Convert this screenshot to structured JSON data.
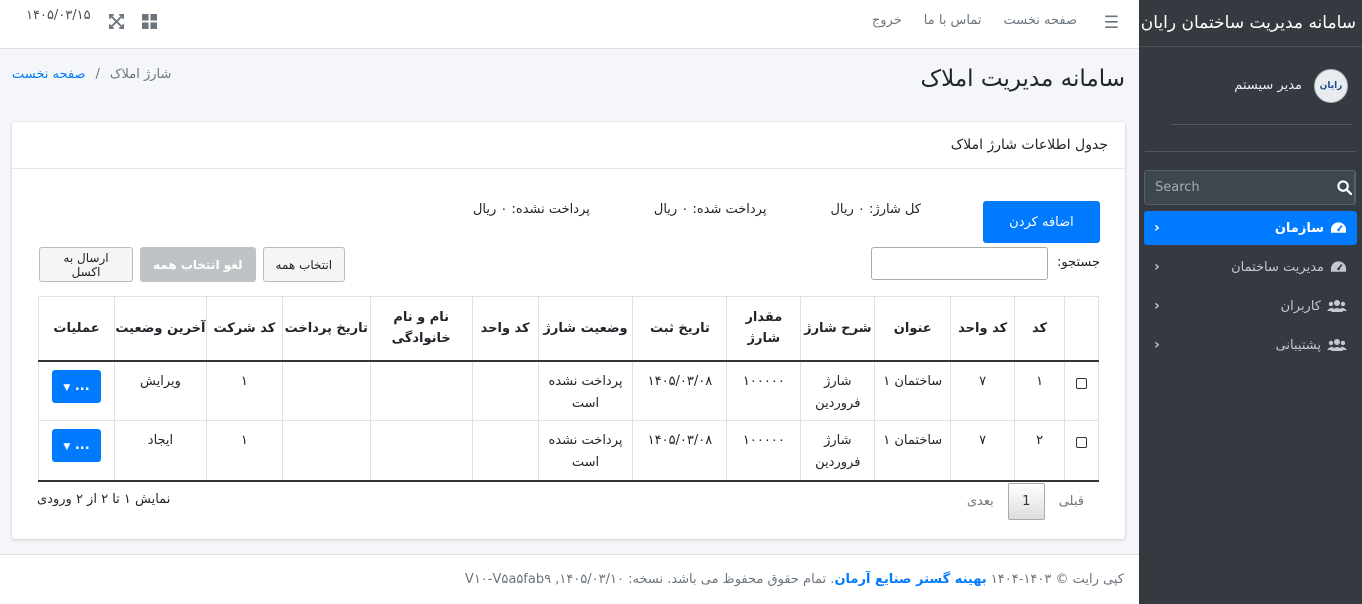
{
  "sidebar": {
    "brand": "سامانه مدیریت ساختمان رایان",
    "user": {
      "name": "مدیر سیستم",
      "avatar_text": "رایان"
    },
    "search": {
      "placeholder": "Search"
    },
    "items": [
      {
        "label": "سازمان",
        "icon": "dashboard-icon",
        "active": true
      },
      {
        "label": "مدیریت ساختمان",
        "icon": "dashboard-icon",
        "active": false
      },
      {
        "label": "کاربران",
        "icon": "users-icon",
        "active": false
      },
      {
        "label": "پشتیبانی",
        "icon": "users-icon",
        "active": false
      }
    ]
  },
  "topbar": {
    "links": [
      "صفحه نخست",
      "تماس با ما",
      "خروج"
    ],
    "date": "۱۴۰۵/۰۳/۱۵"
  },
  "header": {
    "title": "سامانه مدیریت املاک",
    "breadcrumb": {
      "home": "صفحه نخست",
      "separator": "/",
      "current": "شارژ املاک"
    }
  },
  "card": {
    "title": "جدول اطلاعات شارژ املاک",
    "add_button": "اضافه کردن",
    "stats": {
      "total": "کل شارژ: ۰ ریال",
      "paid": "پرداخت شده: ۰ ریال",
      "unpaid": "پرداخت نشده: ۰ ریال"
    },
    "search_label": "جستجو:",
    "buttons": {
      "select_all": "انتخاب همه",
      "deselect_all": "لغو انتخاب همه",
      "export_excel": "ارسال به اکسل"
    },
    "table": {
      "headers": [
        "",
        "کد",
        "کد واحد",
        "عنوان",
        "شرح شارژ",
        "مقدار شارژ",
        "تاریخ ثبت",
        "وضعیت شارژ",
        "کد واحد",
        "نام و نام خانوادگی",
        "تاریخ پرداخت",
        "کد شرکت",
        "آخرین وضعیت",
        "عملیات"
      ],
      "rows": [
        {
          "code": "۱",
          "unit": "۷",
          "title": "ساختمان ۱",
          "desc": "شارژ فروردین",
          "amount": "۱۰۰۰۰۰",
          "date": "۱۴۰۵/۰۳/۰۸",
          "status": "پرداخت نشده است",
          "unit_code": "",
          "name": "",
          "pay_date": "",
          "company": "۱",
          "last_status": "ویرایش",
          "ops": "..."
        },
        {
          "code": "۲",
          "unit": "۷",
          "title": "ساختمان ۱",
          "desc": "شارژ فروردین",
          "amount": "۱۰۰۰۰۰",
          "date": "۱۴۰۵/۰۳/۰۸",
          "status": "پرداخت نشده است",
          "unit_code": "",
          "name": "",
          "pay_date": "",
          "company": "۱",
          "last_status": "ایجاد",
          "ops": "..."
        }
      ]
    },
    "pagination": {
      "prev": "قبلی",
      "current": "1",
      "next": "بعدی"
    },
    "info": "نمایش ۱ تا ۲ از ۲ ورودی"
  },
  "footer": {
    "prefix": "کپی رایت © ۱۴۰۳-۱۴۰۴",
    "company": "بهینه گستر صنایع آرمان",
    "suffix": ". تمام حقوق محفوظ می باشد. نسخه: ۱۴۰۵/۰۳/۱۰, V۱۰-V۵a۵fab۹"
  },
  "colors": {
    "accent": "#007bff",
    "sidebar_bg": "#343a40"
  }
}
